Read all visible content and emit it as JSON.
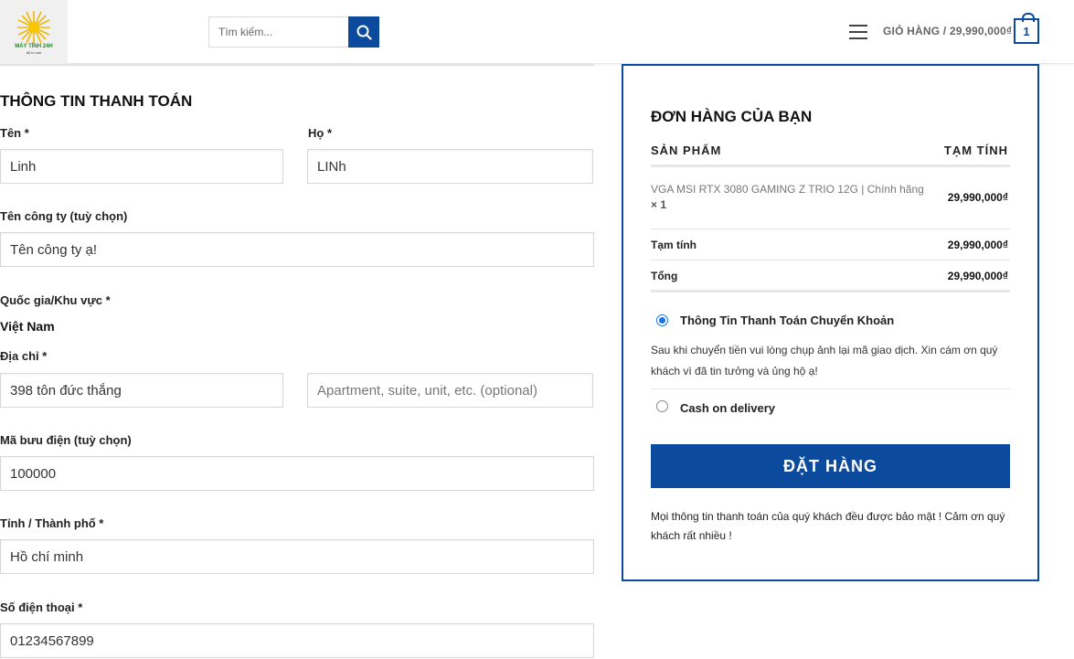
{
  "header": {
    "logo_text": "MÁY TÍNH 24H",
    "logo_sub": "All in one",
    "search_placeholder": "Tìm kiếm...",
    "cart_label": "GIỎ HÀNG / 29,990,000₫",
    "cart_count": "1"
  },
  "billing": {
    "title": "THÔNG TIN THANH TOÁN",
    "first_name": {
      "label": "Tên *",
      "value": "Linh"
    },
    "last_name": {
      "label": "Họ *",
      "value": "LINh"
    },
    "company": {
      "label": "Tên công ty (tuỳ chọn)",
      "value": "Tên công ty ạ!"
    },
    "country": {
      "label": "Quốc gia/Khu vực *",
      "value": "Việt Nam"
    },
    "address": {
      "label": "Địa chỉ *",
      "value": "398 tôn đức thắng",
      "placeholder2": "Apartment, suite, unit, etc. (optional)"
    },
    "postcode": {
      "label": "Mã bưu điện (tuỳ chọn)",
      "value": "100000"
    },
    "city": {
      "label": "Tỉnh / Thành phố *",
      "value": "Hồ chí minh"
    },
    "phone": {
      "label": "Số điện thoại *",
      "value": "01234567899"
    }
  },
  "order": {
    "title": "ĐƠN HÀNG CỦA BẠN",
    "col_product": "SẢN PHẨM",
    "col_subtotal": "TẠM TÍNH",
    "product_name": "VGA MSI RTX 3080 GAMING Z TRIO 12G | Chính hãng",
    "product_qty": "× 1",
    "product_price": "29,990,000₫",
    "subtotal_label": "Tạm tính",
    "subtotal_value": "29,990,000₫",
    "total_label": "Tổng",
    "total_value": "29,990,000₫",
    "payment_bank_label": "Thông Tin Thanh Toán Chuyển Khoản",
    "payment_bank_desc": "Sau khi chuyển tiền vui lòng chụp ảnh lại mã giao dịch. Xin cám ơn quý khách vì đã tin tưởng và ủng hộ ạ!",
    "payment_cod_label": "Cash on delivery",
    "place_order_label": "ĐẶT HÀNG",
    "privacy_text": "Mọi thông tin thanh toán của quý khách đều được bảo mật ! Cảm ơn quý khách rất nhiều !"
  },
  "colors": {
    "brand": "#0b4a9c",
    "radio_checked": "#1a73e8"
  },
  "icons": {
    "search": "search-icon",
    "menu": "hamburger-icon",
    "cart": "cart-bag-icon",
    "logo": "sun-logo-icon"
  }
}
